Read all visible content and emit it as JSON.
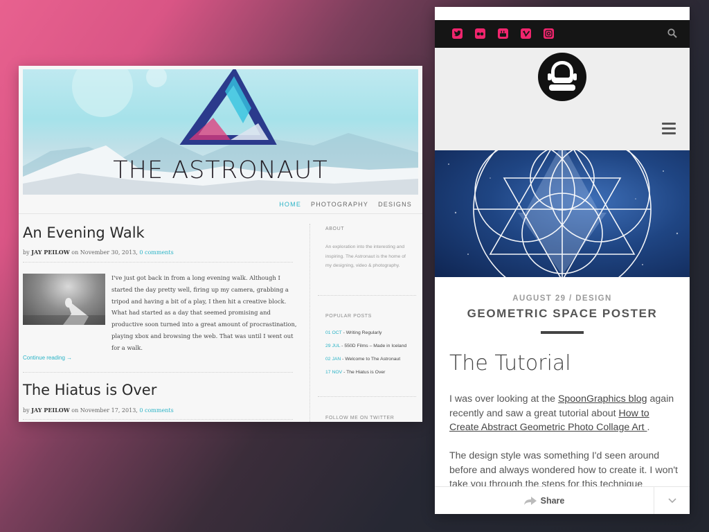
{
  "desktop": {
    "banner": {
      "title": "THE ASTRONAUT"
    },
    "nav": [
      {
        "label": "HOME",
        "active": true
      },
      {
        "label": "PHOTOGRAPHY",
        "active": false
      },
      {
        "label": "DESIGNS",
        "active": false
      }
    ],
    "posts": [
      {
        "title": "An Evening Walk",
        "by": "by ",
        "author": "JAY PEILOW",
        "date": " on November 30, 2013, ",
        "comments": "0 comments",
        "body": "I've just got back in from a long evening walk. Although I started the day pretty well, firing up my camera, grabbing a tripod and having a bit of a play, I then hit a creative block. What had started as a day that seemed promising and productive soon turned into a great amount of procrastination, playing xbox and browsing the web. That was until I went out for a walk.",
        "continue": "Continue reading →"
      },
      {
        "title": "The Hiatus is Over",
        "by": "by ",
        "author": "JAY PEILOW",
        "date": " on November 17, 2013, ",
        "comments": "0 comments"
      }
    ],
    "sidebar": {
      "about_heading": "ABOUT",
      "about_text": "An exploration into the interesting and inspiring. The Astronaut is the home of my designing, video & photography.",
      "popular_heading": "POPULAR POSTS",
      "popular": [
        {
          "date": "01 OCT",
          "title": " - Writing Regularly"
        },
        {
          "date": "29 JUL",
          "title": " - 550D Films – Made in Iceland"
        },
        {
          "date": "02 JAN",
          "title": " - Welcome to The Astronaut"
        },
        {
          "date": "17 NOV",
          "title": " - The Hiatus is Over"
        }
      ],
      "twitter_heading": "FOLLOW ME ON TWITTER"
    }
  },
  "mobile": {
    "social_icons": [
      "twitter-icon",
      "flickr-icon",
      "youtube-icon",
      "vimeo-icon",
      "instagram-icon"
    ],
    "accent": "#f0256d",
    "post_meta": "AUGUST 29 / DESIGN",
    "post_title": "GEOMETRIC SPACE POSTER",
    "heading": "The Tutorial",
    "p1": {
      "a": "I was over looking at the ",
      "link1": "SpoonGraphics blog",
      "b": " again recently and saw a great tutorial about ",
      "link2": "How to Create Abstract Geometric Photo Collage Art ",
      "c": "."
    },
    "p2": "The design style was something I'd seen around before and always wondered how to create it. I won't take you through the steps for this technique",
    "share_label": "Share"
  }
}
